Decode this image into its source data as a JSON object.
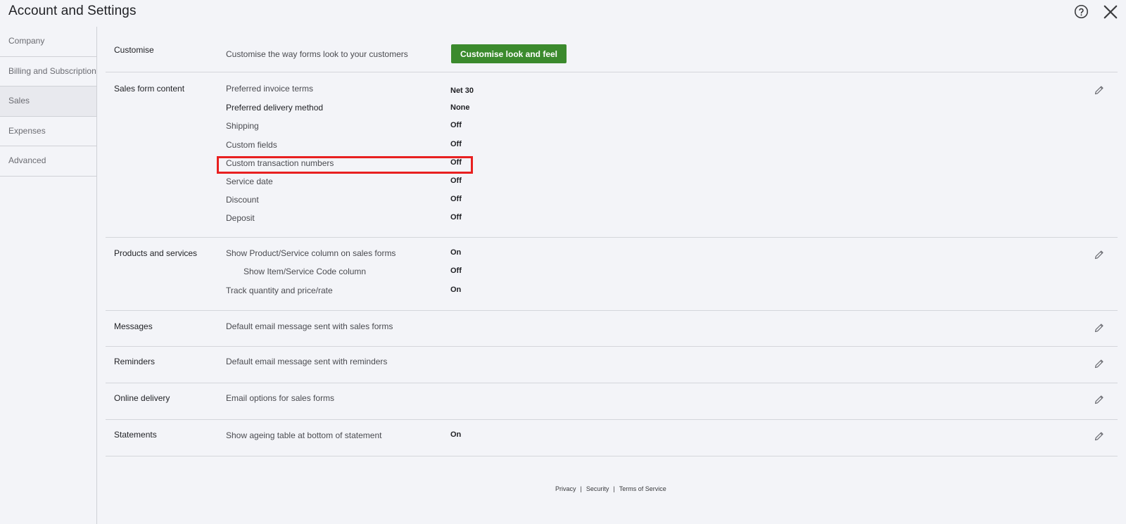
{
  "header": {
    "title": "Account and Settings"
  },
  "sidebar": {
    "items": [
      {
        "label": "Company"
      },
      {
        "label": "Billing and Subscription"
      },
      {
        "label": "Sales"
      },
      {
        "label": "Expenses"
      },
      {
        "label": "Advanced"
      }
    ],
    "active": "Sales"
  },
  "sections": {
    "customise": {
      "title": "Customise",
      "description": "Customise the way forms look to your customers",
      "button": "Customise look and feel"
    },
    "sales_form_content": {
      "title": "Sales form content",
      "rows": [
        {
          "label": "Preferred invoice terms",
          "value": "Net 30"
        },
        {
          "label": "Preferred delivery method",
          "value": "None"
        },
        {
          "label": "Shipping",
          "value": "Off"
        },
        {
          "label": "Custom fields",
          "value": "Off"
        },
        {
          "label": "Custom transaction numbers",
          "value": "Off"
        },
        {
          "label": "Service date",
          "value": "Off"
        },
        {
          "label": "Discount",
          "value": "Off"
        },
        {
          "label": "Deposit",
          "value": "Off"
        }
      ]
    },
    "products_services": {
      "title": "Products and services",
      "rows": [
        {
          "label": "Show Product/Service column on sales forms",
          "value": "On"
        },
        {
          "label": "Show Item/Service Code column",
          "value": "Off"
        },
        {
          "label": "Track quantity and price/rate",
          "value": "On"
        }
      ]
    },
    "messages": {
      "title": "Messages",
      "description": "Default email message sent with sales forms"
    },
    "reminders": {
      "title": "Reminders",
      "description": "Default email message sent with reminders"
    },
    "online_delivery": {
      "title": "Online delivery",
      "description": "Email options for sales forms"
    },
    "statements": {
      "title": "Statements",
      "description": "Show ageing table at bottom of statement",
      "value": "On"
    }
  },
  "footer": {
    "privacy": "Privacy",
    "security": "Security",
    "terms": "Terms of Service",
    "separator": "|"
  },
  "icons": {
    "help": "help-icon",
    "close": "close-icon",
    "edit": "pencil-icon"
  },
  "colors": {
    "primary_button": "#3b8a2d",
    "highlight": "#e82020"
  }
}
